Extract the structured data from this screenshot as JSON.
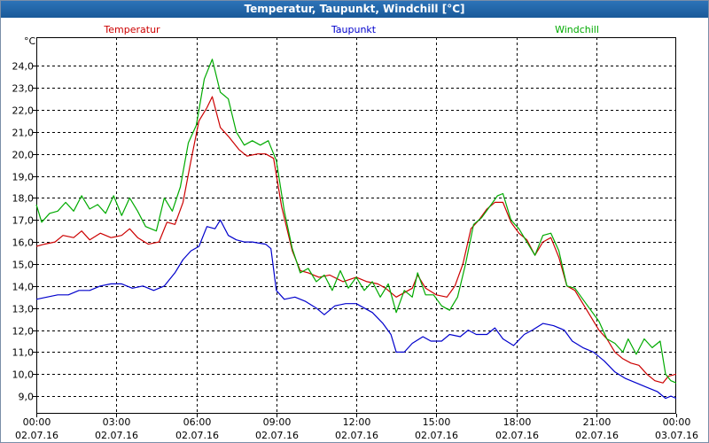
{
  "window": {
    "title": "Temperatur, Taupunkt, Windchill [°C]"
  },
  "chart_data": {
    "type": "line",
    "title": "Temperatur, Taupunkt, Windchill [°C]",
    "ylabel": "°C",
    "xlabel": "",
    "ylim": [
      8.2,
      25.3
    ],
    "y_ticks": [
      9.0,
      10.0,
      11.0,
      12.0,
      13.0,
      14.0,
      15.0,
      16.0,
      17.0,
      18.0,
      19.0,
      20.0,
      21.0,
      22.0,
      23.0,
      24.0
    ],
    "y_tick_labels": [
      "9,0",
      "10,0",
      "11,0",
      "12,0",
      "13,0",
      "14,0",
      "15,0",
      "16,0",
      "17,0",
      "18,0",
      "19,0",
      "20,0",
      "21,0",
      "22,0",
      "23,0",
      "24,0"
    ],
    "xlim": [
      0,
      24
    ],
    "x_ticks": [
      {
        "h": 0,
        "time": "00:00",
        "date": "02.07.16"
      },
      {
        "h": 3,
        "time": "03:00",
        "date": "02.07.16"
      },
      {
        "h": 6,
        "time": "06:00",
        "date": "02.07.16"
      },
      {
        "h": 9,
        "time": "09:00",
        "date": "02.07.16"
      },
      {
        "h": 12,
        "time": "12:00",
        "date": "02.07.16"
      },
      {
        "h": 15,
        "time": "15:00",
        "date": "02.07.16"
      },
      {
        "h": 18,
        "time": "18:00",
        "date": "02.07.16"
      },
      {
        "h": 21,
        "time": "21:00",
        "date": "02.07.16"
      },
      {
        "h": 24,
        "time": "00:00",
        "date": "03.07.16"
      }
    ],
    "grid": true,
    "legend_position": "top",
    "series": [
      {
        "name": "Temperatur",
        "color": "#cc0000",
        "points": [
          [
            0,
            15.8
          ],
          [
            0.3,
            15.9
          ],
          [
            0.7,
            16.0
          ],
          [
            1.0,
            16.3
          ],
          [
            1.4,
            16.2
          ],
          [
            1.7,
            16.5
          ],
          [
            2.0,
            16.1
          ],
          [
            2.4,
            16.4
          ],
          [
            2.8,
            16.2
          ],
          [
            3.2,
            16.3
          ],
          [
            3.5,
            16.6
          ],
          [
            3.8,
            16.2
          ],
          [
            4.2,
            15.9
          ],
          [
            4.6,
            16.0
          ],
          [
            4.9,
            16.9
          ],
          [
            5.2,
            16.8
          ],
          [
            5.5,
            17.8
          ],
          [
            5.8,
            19.7
          ],
          [
            6.1,
            21.5
          ],
          [
            6.4,
            22.1
          ],
          [
            6.6,
            22.6
          ],
          [
            6.9,
            21.2
          ],
          [
            7.2,
            20.8
          ],
          [
            7.6,
            20.2
          ],
          [
            7.9,
            19.9
          ],
          [
            8.3,
            20.0
          ],
          [
            8.6,
            20.0
          ],
          [
            8.9,
            19.8
          ],
          [
            9.2,
            17.6
          ],
          [
            9.6,
            15.6
          ],
          [
            9.9,
            14.7
          ],
          [
            10.2,
            14.6
          ],
          [
            10.6,
            14.4
          ],
          [
            11.0,
            14.5
          ],
          [
            11.5,
            14.2
          ],
          [
            12.0,
            14.4
          ],
          [
            12.4,
            14.2
          ],
          [
            12.8,
            14.1
          ],
          [
            13.1,
            13.9
          ],
          [
            13.5,
            13.5
          ],
          [
            13.8,
            13.7
          ],
          [
            14.1,
            13.9
          ],
          [
            14.3,
            14.5
          ],
          [
            14.6,
            13.9
          ],
          [
            15.0,
            13.6
          ],
          [
            15.4,
            13.5
          ],
          [
            15.7,
            14.0
          ],
          [
            16.0,
            15.0
          ],
          [
            16.3,
            16.6
          ],
          [
            16.6,
            17.0
          ],
          [
            16.9,
            17.5
          ],
          [
            17.2,
            17.8
          ],
          [
            17.5,
            17.8
          ],
          [
            17.8,
            16.9
          ],
          [
            18.1,
            16.4
          ],
          [
            18.4,
            16.1
          ],
          [
            18.7,
            15.4
          ],
          [
            19.0,
            16.0
          ],
          [
            19.3,
            16.2
          ],
          [
            19.6,
            15.3
          ],
          [
            19.9,
            14.0
          ],
          [
            20.2,
            13.8
          ],
          [
            20.5,
            13.2
          ],
          [
            20.8,
            12.6
          ],
          [
            21.1,
            12.0
          ],
          [
            21.4,
            11.6
          ],
          [
            21.7,
            11.0
          ],
          [
            22.0,
            10.7
          ],
          [
            22.3,
            10.5
          ],
          [
            22.6,
            10.4
          ],
          [
            22.9,
            10.0
          ],
          [
            23.2,
            9.7
          ],
          [
            23.5,
            9.6
          ],
          [
            23.7,
            9.9
          ],
          [
            24.0,
            10.0
          ]
        ]
      },
      {
        "name": "Taupunkt",
        "color": "#0000cc",
        "points": [
          [
            0,
            13.4
          ],
          [
            0.4,
            13.5
          ],
          [
            0.8,
            13.6
          ],
          [
            1.2,
            13.6
          ],
          [
            1.6,
            13.8
          ],
          [
            2.0,
            13.8
          ],
          [
            2.4,
            14.0
          ],
          [
            2.8,
            14.1
          ],
          [
            3.2,
            14.1
          ],
          [
            3.6,
            13.9
          ],
          [
            4.0,
            14.0
          ],
          [
            4.4,
            13.8
          ],
          [
            4.8,
            14.0
          ],
          [
            5.2,
            14.6
          ],
          [
            5.5,
            15.2
          ],
          [
            5.8,
            15.6
          ],
          [
            6.1,
            15.8
          ],
          [
            6.4,
            16.7
          ],
          [
            6.7,
            16.6
          ],
          [
            6.9,
            17.0
          ],
          [
            7.2,
            16.3
          ],
          [
            7.5,
            16.1
          ],
          [
            7.8,
            16.0
          ],
          [
            8.1,
            16.0
          ],
          [
            8.6,
            15.9
          ],
          [
            8.8,
            15.7
          ],
          [
            9.0,
            13.8
          ],
          [
            9.3,
            13.4
          ],
          [
            9.7,
            13.5
          ],
          [
            10.1,
            13.3
          ],
          [
            10.5,
            13.0
          ],
          [
            10.8,
            12.7
          ],
          [
            11.2,
            13.1
          ],
          [
            11.6,
            13.2
          ],
          [
            12.0,
            13.2
          ],
          [
            12.3,
            13.0
          ],
          [
            12.6,
            12.8
          ],
          [
            13.0,
            12.3
          ],
          [
            13.3,
            11.8
          ],
          [
            13.5,
            11.0
          ],
          [
            13.8,
            11.0
          ],
          [
            14.1,
            11.4
          ],
          [
            14.5,
            11.7
          ],
          [
            14.8,
            11.5
          ],
          [
            15.2,
            11.5
          ],
          [
            15.5,
            11.8
          ],
          [
            15.9,
            11.7
          ],
          [
            16.2,
            12.0
          ],
          [
            16.5,
            11.8
          ],
          [
            16.9,
            11.8
          ],
          [
            17.2,
            12.1
          ],
          [
            17.5,
            11.6
          ],
          [
            17.9,
            11.3
          ],
          [
            18.3,
            11.8
          ],
          [
            18.6,
            12.0
          ],
          [
            19.0,
            12.3
          ],
          [
            19.4,
            12.2
          ],
          [
            19.8,
            12.0
          ],
          [
            20.1,
            11.5
          ],
          [
            20.5,
            11.2
          ],
          [
            20.9,
            11.0
          ],
          [
            21.3,
            10.6
          ],
          [
            21.7,
            10.1
          ],
          [
            22.1,
            9.8
          ],
          [
            22.5,
            9.6
          ],
          [
            22.9,
            9.4
          ],
          [
            23.3,
            9.2
          ],
          [
            23.6,
            8.9
          ],
          [
            23.8,
            9.0
          ],
          [
            24.0,
            8.9
          ]
        ]
      },
      {
        "name": "Windchill",
        "color": "#00aa00",
        "points": [
          [
            0,
            17.7
          ],
          [
            0.2,
            16.9
          ],
          [
            0.5,
            17.3
          ],
          [
            0.8,
            17.4
          ],
          [
            1.1,
            17.8
          ],
          [
            1.4,
            17.4
          ],
          [
            1.7,
            18.1
          ],
          [
            2.0,
            17.5
          ],
          [
            2.3,
            17.7
          ],
          [
            2.6,
            17.3
          ],
          [
            2.9,
            18.1
          ],
          [
            3.2,
            17.2
          ],
          [
            3.5,
            18.0
          ],
          [
            3.8,
            17.4
          ],
          [
            4.1,
            16.7
          ],
          [
            4.5,
            16.5
          ],
          [
            4.8,
            18.0
          ],
          [
            5.1,
            17.4
          ],
          [
            5.4,
            18.5
          ],
          [
            5.7,
            20.5
          ],
          [
            6.0,
            21.3
          ],
          [
            6.3,
            23.4
          ],
          [
            6.6,
            24.3
          ],
          [
            6.9,
            22.8
          ],
          [
            7.2,
            22.5
          ],
          [
            7.5,
            21.0
          ],
          [
            7.8,
            20.4
          ],
          [
            8.1,
            20.6
          ],
          [
            8.4,
            20.4
          ],
          [
            8.7,
            20.6
          ],
          [
            9.0,
            19.7
          ],
          [
            9.3,
            17.4
          ],
          [
            9.6,
            15.7
          ],
          [
            9.9,
            14.6
          ],
          [
            10.2,
            14.8
          ],
          [
            10.5,
            14.2
          ],
          [
            10.8,
            14.5
          ],
          [
            11.1,
            13.8
          ],
          [
            11.4,
            14.7
          ],
          [
            11.7,
            13.9
          ],
          [
            12.0,
            14.4
          ],
          [
            12.3,
            13.8
          ],
          [
            12.6,
            14.2
          ],
          [
            12.9,
            13.5
          ],
          [
            13.2,
            14.1
          ],
          [
            13.5,
            12.8
          ],
          [
            13.8,
            13.8
          ],
          [
            14.1,
            13.5
          ],
          [
            14.3,
            14.6
          ],
          [
            14.6,
            13.6
          ],
          [
            14.9,
            13.6
          ],
          [
            15.2,
            13.1
          ],
          [
            15.5,
            12.9
          ],
          [
            15.8,
            13.5
          ],
          [
            16.1,
            15.0
          ],
          [
            16.4,
            16.8
          ],
          [
            16.7,
            17.1
          ],
          [
            17.0,
            17.6
          ],
          [
            17.3,
            18.1
          ],
          [
            17.5,
            18.2
          ],
          [
            17.8,
            17.0
          ],
          [
            18.1,
            16.6
          ],
          [
            18.4,
            16.0
          ],
          [
            18.7,
            15.4
          ],
          [
            19.0,
            16.3
          ],
          [
            19.3,
            16.4
          ],
          [
            19.6,
            15.6
          ],
          [
            19.9,
            14.0
          ],
          [
            20.2,
            13.9
          ],
          [
            20.5,
            13.4
          ],
          [
            20.8,
            12.9
          ],
          [
            21.1,
            12.4
          ],
          [
            21.4,
            11.6
          ],
          [
            21.7,
            11.4
          ],
          [
            22.0,
            11.0
          ],
          [
            22.2,
            11.6
          ],
          [
            22.5,
            10.9
          ],
          [
            22.8,
            11.6
          ],
          [
            23.1,
            11.2
          ],
          [
            23.4,
            11.5
          ],
          [
            23.6,
            10.0
          ],
          [
            23.8,
            9.7
          ],
          [
            24.0,
            9.6
          ]
        ]
      }
    ]
  }
}
